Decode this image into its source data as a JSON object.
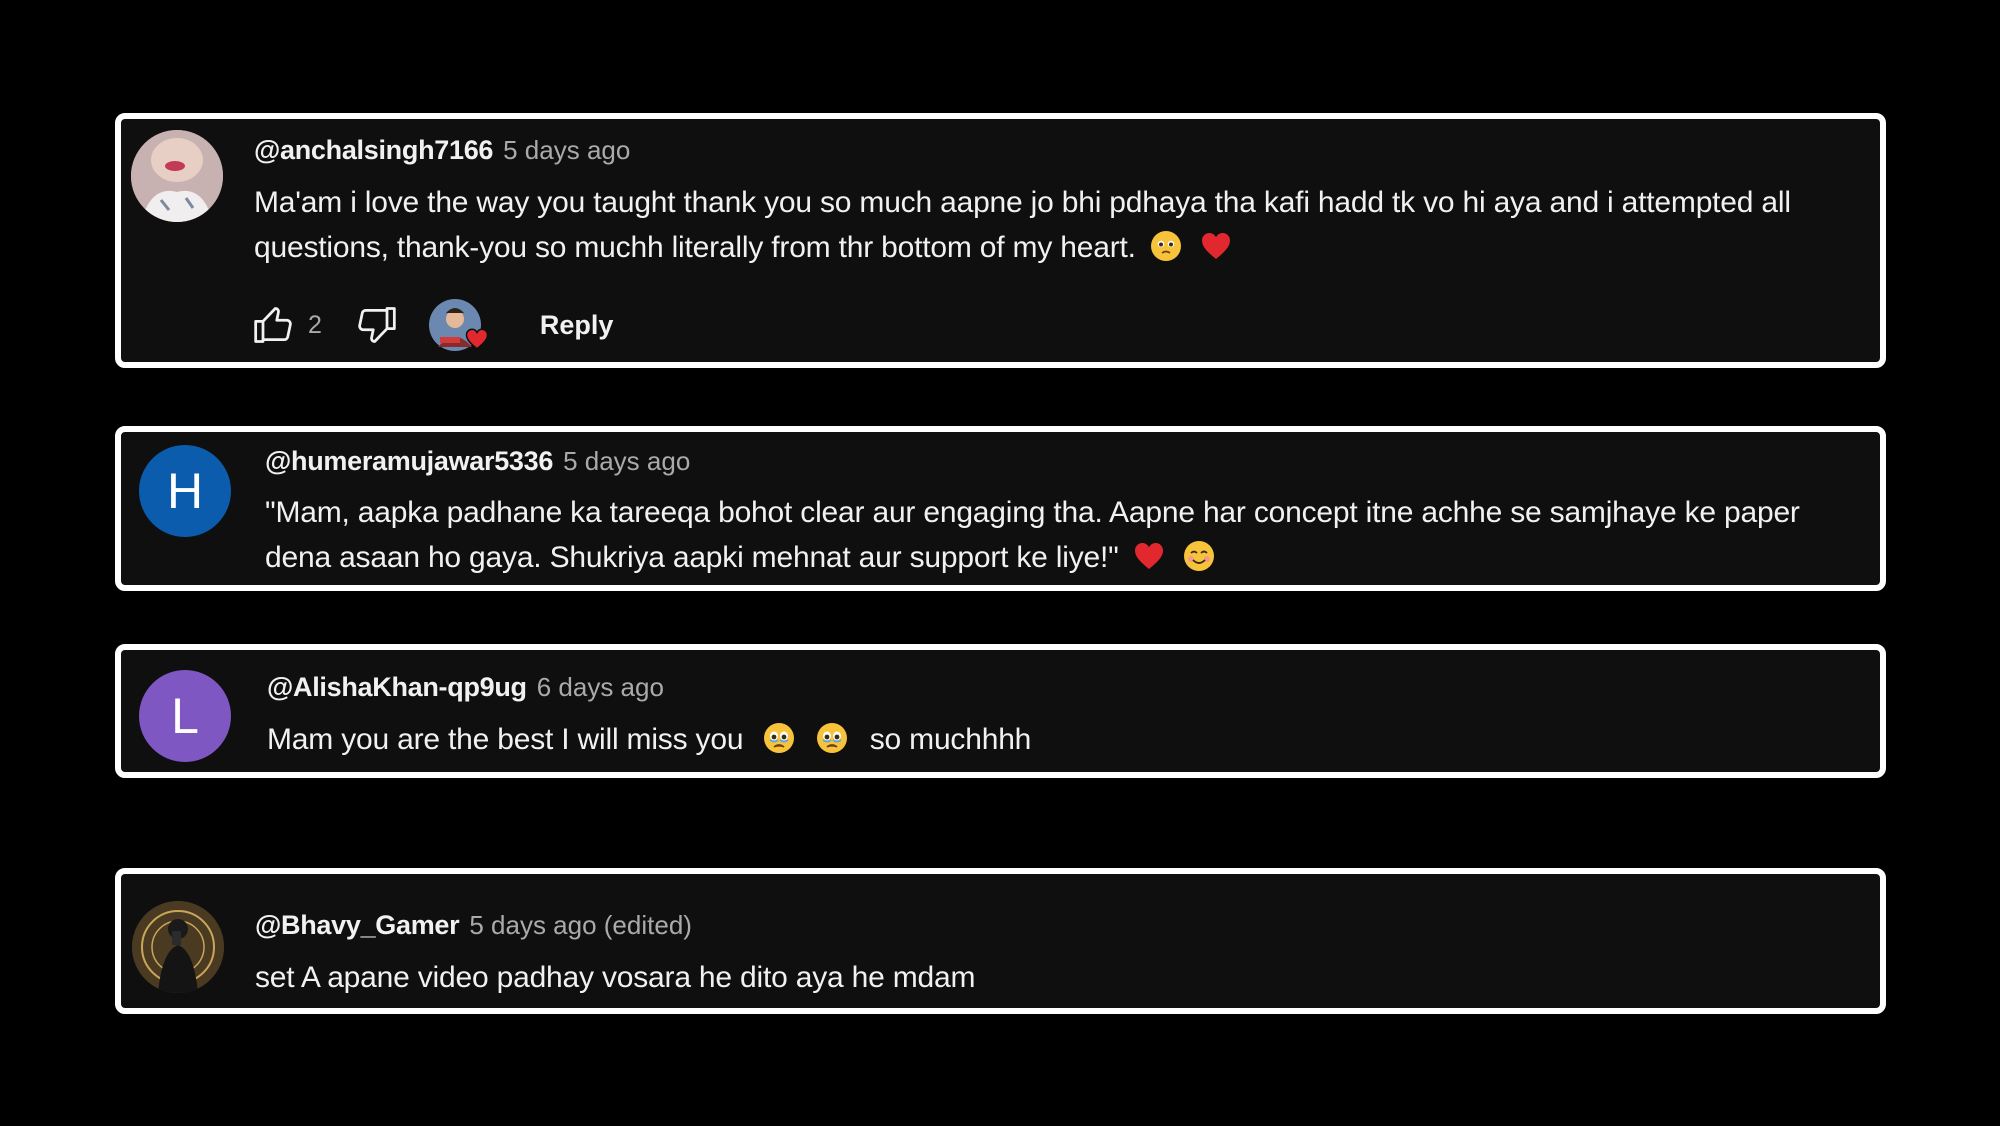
{
  "comments": [
    {
      "handle": "@anchalsingh7166",
      "time": "5 days ago",
      "text": "Ma'am i love the way you taught thank you so much aapne jo bhi pdhaya tha kafi hadd tk vo hi aya and i attempted all questions, thank-you so muchh literally from thr bottom of my heart.",
      "emojis": [
        "pleading-face-emoji",
        "red-heart-emoji"
      ],
      "avatar": "photo",
      "likes": "2",
      "reply_label": "Reply"
    },
    {
      "handle": "@humeramujawar5336",
      "time": "5 days ago",
      "text": "\"Mam, aapka padhane ka tareeqa bohot clear aur engaging tha. Aapne har concept itne achhe se samjhaye ke paper dena asaan ho gaya. Shukriya aapki mehnat aur support ke liye!\"",
      "emojis": [
        "red-heart-emoji",
        "smiling-face-emoji"
      ],
      "avatar_letter": "H",
      "avatar_color": "#0b5cad"
    },
    {
      "handle": "@AlishaKhan-qp9ug",
      "time": "6 days ago",
      "text_before": "Mam you are the best I will miss you",
      "text_after": "so muchhhh",
      "emojis": [
        "holding-back-tears-emoji",
        "holding-back-tears-emoji"
      ],
      "avatar_letter": "L",
      "avatar_color": "#7e57c2"
    },
    {
      "handle": "@Bhavy_Gamer",
      "time": "5 days ago (edited)",
      "text": "set A apane video padhay vosara he dito aya he mdam",
      "avatar": "photo"
    }
  ],
  "colors": {
    "card_bg": "#0f0f0f",
    "border": "#ffffff",
    "secondary_text": "#aaaaaa",
    "heart": "#e0282e"
  }
}
